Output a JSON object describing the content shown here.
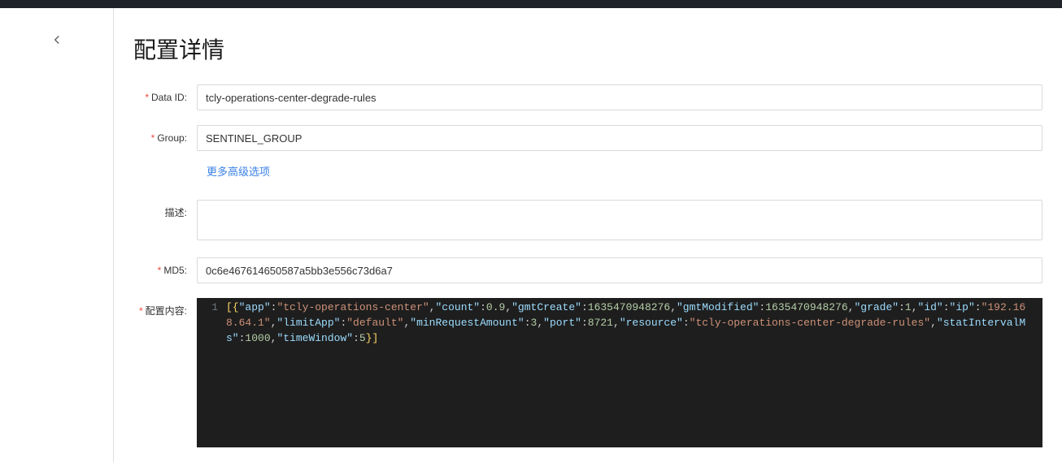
{
  "header": {
    "page_title": "配置详情"
  },
  "form": {
    "data_id": {
      "label": "Data ID:",
      "value": "tcly-operations-center-degrade-rules",
      "required": true
    },
    "group": {
      "label": "Group:",
      "value": "SENTINEL_GROUP",
      "required": true
    },
    "more_options_label": "更多高级选项",
    "description": {
      "label": "描述:",
      "value": "",
      "required": false
    },
    "md5": {
      "label": "MD5:",
      "value": "0c6e467614650587a5bb3e556c73d6a7",
      "required": true
    },
    "content": {
      "label": "配置内容:",
      "required": true
    }
  },
  "editor": {
    "line_number": "1",
    "content_raw": "[{\"app\":\"tcly-operations-center\",\"count\":0.9,\"gmtCreate\":1635470948276,\"gmtModified\":1635470948276,\"grade\":1,\"id\":\"ip\":\"192.168.64.1\",\"limitApp\":\"default\",\"minRequestAmount\":3,\"port\":8721,\"resource\":\"tcly-operations-center-degrade-rules\",\"statIntervalMs\":1000,\"timeWindow\":5}]",
    "tokens": [
      {
        "t": "bracket",
        "v": "[{"
      },
      {
        "t": "key",
        "v": "\"app\""
      },
      {
        "t": "punct",
        "v": ":"
      },
      {
        "t": "str",
        "v": "\"tcly-operations-center\""
      },
      {
        "t": "punct",
        "v": ","
      },
      {
        "t": "key",
        "v": "\"count\""
      },
      {
        "t": "punct",
        "v": ":"
      },
      {
        "t": "num",
        "v": "0.9"
      },
      {
        "t": "punct",
        "v": ","
      },
      {
        "t": "key",
        "v": "\"gmtCreate\""
      },
      {
        "t": "punct",
        "v": ":"
      },
      {
        "t": "num",
        "v": "1635470948276"
      },
      {
        "t": "punct",
        "v": ","
      },
      {
        "t": "key",
        "v": "\"gmtModified\""
      },
      {
        "t": "punct",
        "v": ":"
      },
      {
        "t": "num",
        "v": "1635470948276"
      },
      {
        "t": "punct",
        "v": ","
      },
      {
        "t": "key",
        "v": "\"grade\""
      },
      {
        "t": "punct",
        "v": ":"
      },
      {
        "t": "num",
        "v": "1"
      },
      {
        "t": "punct",
        "v": ","
      },
      {
        "t": "key",
        "v": "\"id\""
      },
      {
        "t": "punct",
        "v": ":"
      },
      {
        "t": "key",
        "v": "\"ip\""
      },
      {
        "t": "punct",
        "v": ":"
      },
      {
        "t": "str",
        "v": "\"192.168.64.1\""
      },
      {
        "t": "punct",
        "v": ","
      },
      {
        "t": "key",
        "v": "\"limitApp\""
      },
      {
        "t": "punct",
        "v": ":"
      },
      {
        "t": "str",
        "v": "\"default\""
      },
      {
        "t": "punct",
        "v": ","
      },
      {
        "t": "key",
        "v": "\"minRequestAmount\""
      },
      {
        "t": "punct",
        "v": ":"
      },
      {
        "t": "num",
        "v": "3"
      },
      {
        "t": "punct",
        "v": ","
      },
      {
        "t": "key",
        "v": "\"port\""
      },
      {
        "t": "punct",
        "v": ":"
      },
      {
        "t": "num",
        "v": "8721"
      },
      {
        "t": "punct",
        "v": ","
      },
      {
        "t": "key",
        "v": "\"resource\""
      },
      {
        "t": "punct",
        "v": ":"
      },
      {
        "t": "str",
        "v": "\"tcly-operations-center-degrade-rules\""
      },
      {
        "t": "punct",
        "v": ","
      },
      {
        "t": "key",
        "v": "\"statIntervalMs\""
      },
      {
        "t": "punct",
        "v": ":"
      },
      {
        "t": "num",
        "v": "1000"
      },
      {
        "t": "punct",
        "v": ","
      },
      {
        "t": "key",
        "v": "\"timeWindow\""
      },
      {
        "t": "punct",
        "v": ":"
      },
      {
        "t": "num",
        "v": "5"
      },
      {
        "t": "bracket",
        "v": "}]"
      }
    ]
  }
}
